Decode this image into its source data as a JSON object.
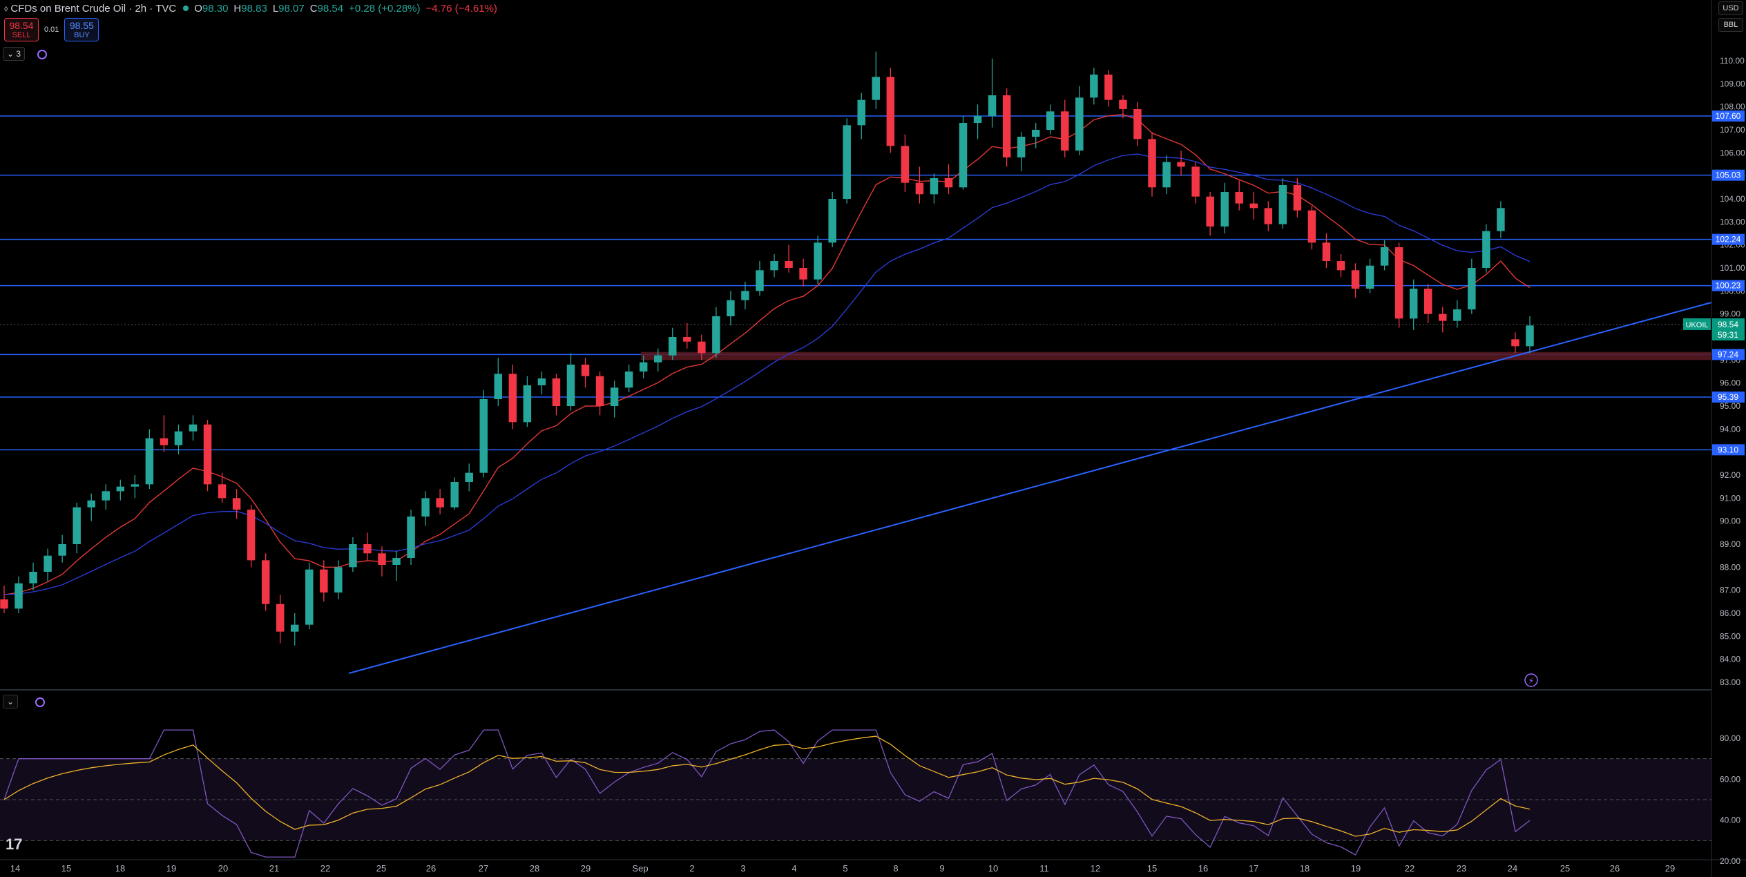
{
  "header": {
    "title": "CFDs on Brent Crude Oil · 2h · TVC",
    "open_label": "O",
    "open": "98.30",
    "high_label": "H",
    "high": "98.83",
    "low_label": "L",
    "low": "98.07",
    "close_label": "C",
    "close": "98.54",
    "change": "+0.28 (+0.28%)",
    "change2": "−4.76 (−4.61%)"
  },
  "trade": {
    "sell_price": "98.54",
    "sell_label": "SELL",
    "spread": "0.01",
    "buy_price": "98.55",
    "buy_label": "BUY"
  },
  "indicators_count": "3",
  "currency": "USD",
  "unit": "BBL",
  "colors": {
    "up": "#26a69a",
    "down": "#f23645",
    "hline": "#2962ff",
    "ma_fast": "#e53935",
    "ma_slow": "#2a3bd6",
    "rsi": "#7e57c2",
    "rsi_ma": "#f0b429"
  },
  "price_axis": {
    "ticks": [
      "110.00",
      "109.00",
      "108.00",
      "107.00",
      "106.00",
      "105.00",
      "104.00",
      "103.00",
      "102.00",
      "101.00",
      "100.00",
      "99.00",
      "98.00",
      "97.00",
      "96.00",
      "95.00",
      "94.00",
      "93.00",
      "92.00",
      "91.00",
      "90.00",
      "89.00",
      "88.00",
      "87.00",
      "86.00",
      "85.00",
      "84.00",
      "83.00"
    ],
    "levels": [
      "107.60",
      "105.03",
      "102.24",
      "100.23",
      "97.24",
      "95.39",
      "93.10"
    ],
    "current": {
      "symbol": "UKOIL",
      "price": "98.54",
      "countdown": "59:31"
    }
  },
  "rsi_axis": {
    "ticks": [
      "80.00",
      "60.00",
      "40.00",
      "20.00"
    ]
  },
  "time_axis": {
    "labels": [
      "14",
      "15",
      "18",
      "19",
      "20",
      "21",
      "22",
      "25",
      "26",
      "27",
      "28",
      "29",
      "Sep",
      "2",
      "3",
      "4",
      "5",
      "8",
      "9",
      "10",
      "11",
      "12",
      "15",
      "16",
      "17",
      "18",
      "19",
      "22",
      "23",
      "24",
      "25",
      "26",
      "29"
    ]
  },
  "chart_data": {
    "type": "candlestick",
    "symbol": "UKOIL",
    "timeframe": "2h",
    "ylim": [
      83,
      110.5
    ],
    "candles_ohlc_approx": [
      [
        86.6,
        87.2,
        86.0,
        86.2
      ],
      [
        86.2,
        87.6,
        86.0,
        87.3
      ],
      [
        87.3,
        88.2,
        87.0,
        87.8
      ],
      [
        87.8,
        88.8,
        87.4,
        88.5
      ],
      [
        88.5,
        89.4,
        88.2,
        89.0
      ],
      [
        89.0,
        90.8,
        88.6,
        90.6
      ],
      [
        90.6,
        91.2,
        90.0,
        90.9
      ],
      [
        90.9,
        91.6,
        90.5,
        91.3
      ],
      [
        91.3,
        91.8,
        90.9,
        91.5
      ],
      [
        91.5,
        92.0,
        91.0,
        91.6
      ],
      [
        91.6,
        94.0,
        91.4,
        93.6
      ],
      [
        93.6,
        94.6,
        93.0,
        93.3
      ],
      [
        93.3,
        94.2,
        92.9,
        93.9
      ],
      [
        93.9,
        94.6,
        93.5,
        94.2
      ],
      [
        94.2,
        94.4,
        91.3,
        91.6
      ],
      [
        91.6,
        92.1,
        90.8,
        91.0
      ],
      [
        91.0,
        91.4,
        90.1,
        90.5
      ],
      [
        90.5,
        90.7,
        88.0,
        88.3
      ],
      [
        88.3,
        88.6,
        86.1,
        86.4
      ],
      [
        86.4,
        86.8,
        84.7,
        85.2
      ],
      [
        85.2,
        86.0,
        84.6,
        85.5
      ],
      [
        85.5,
        88.2,
        85.3,
        87.9
      ],
      [
        87.9,
        88.3,
        86.5,
        86.9
      ],
      [
        86.9,
        88.3,
        86.6,
        88.0
      ],
      [
        88.0,
        89.3,
        87.8,
        89.0
      ],
      [
        89.0,
        89.5,
        88.3,
        88.6
      ],
      [
        88.6,
        88.9,
        87.6,
        88.1
      ],
      [
        88.1,
        88.7,
        87.4,
        88.4
      ],
      [
        88.4,
        90.5,
        88.1,
        90.2
      ],
      [
        90.2,
        91.3,
        89.8,
        91.0
      ],
      [
        91.0,
        91.4,
        90.3,
        90.6
      ],
      [
        90.6,
        91.9,
        90.5,
        91.7
      ],
      [
        91.7,
        92.5,
        91.3,
        92.1
      ],
      [
        92.1,
        95.7,
        91.9,
        95.3
      ],
      [
        95.3,
        97.1,
        95.0,
        96.4
      ],
      [
        96.4,
        96.8,
        94.0,
        94.3
      ],
      [
        94.3,
        96.3,
        94.1,
        95.9
      ],
      [
        95.9,
        96.5,
        95.5,
        96.2
      ],
      [
        96.2,
        96.4,
        94.6,
        95.0
      ],
      [
        95.0,
        97.3,
        94.8,
        96.8
      ],
      [
        96.8,
        97.1,
        95.8,
        96.3
      ],
      [
        96.3,
        96.5,
        94.6,
        95.0
      ],
      [
        95.0,
        96.1,
        94.5,
        95.8
      ],
      [
        95.8,
        96.8,
        95.6,
        96.5
      ],
      [
        96.5,
        97.2,
        96.2,
        96.9
      ],
      [
        96.9,
        97.5,
        96.5,
        97.2
      ],
      [
        97.2,
        98.4,
        97.0,
        98.0
      ],
      [
        98.0,
        98.6,
        97.5,
        97.8
      ],
      [
        97.8,
        98.1,
        97.0,
        97.3
      ],
      [
        97.3,
        99.3,
        97.1,
        98.9
      ],
      [
        98.9,
        100.0,
        98.5,
        99.6
      ],
      [
        99.6,
        100.4,
        99.2,
        100.0
      ],
      [
        100.0,
        101.3,
        99.8,
        100.9
      ],
      [
        100.9,
        101.6,
        100.6,
        101.3
      ],
      [
        101.3,
        102.0,
        100.8,
        101.0
      ],
      [
        101.0,
        101.4,
        100.2,
        100.5
      ],
      [
        100.5,
        102.4,
        100.3,
        102.1
      ],
      [
        102.1,
        104.3,
        101.9,
        104.0
      ],
      [
        104.0,
        107.5,
        103.8,
        107.2
      ],
      [
        107.2,
        108.6,
        106.6,
        108.3
      ],
      [
        108.3,
        110.4,
        107.9,
        109.3
      ],
      [
        109.3,
        109.7,
        106.0,
        106.3
      ],
      [
        106.3,
        106.8,
        104.3,
        104.7
      ],
      [
        104.7,
        105.4,
        103.8,
        104.2
      ],
      [
        104.2,
        105.1,
        103.8,
        104.9
      ],
      [
        104.9,
        105.5,
        104.2,
        104.5
      ],
      [
        104.5,
        107.6,
        104.4,
        107.3
      ],
      [
        107.3,
        108.1,
        106.6,
        107.6
      ],
      [
        107.6,
        110.1,
        107.1,
        108.5
      ],
      [
        108.5,
        108.8,
        105.4,
        105.8
      ],
      [
        105.8,
        106.9,
        105.2,
        106.7
      ],
      [
        106.7,
        107.3,
        106.2,
        107.0
      ],
      [
        107.0,
        108.1,
        106.8,
        107.8
      ],
      [
        107.8,
        108.3,
        105.8,
        106.1
      ],
      [
        106.1,
        108.9,
        105.9,
        108.4
      ],
      [
        108.4,
        109.7,
        108.1,
        109.4
      ],
      [
        109.4,
        109.6,
        108.0,
        108.3
      ],
      [
        108.3,
        108.5,
        107.5,
        107.9
      ],
      [
        107.9,
        108.2,
        106.3,
        106.6
      ],
      [
        106.6,
        106.9,
        104.1,
        104.5
      ],
      [
        104.5,
        105.9,
        104.2,
        105.6
      ],
      [
        105.6,
        106.1,
        105.0,
        105.4
      ],
      [
        105.4,
        105.6,
        103.8,
        104.1
      ],
      [
        104.1,
        104.3,
        102.4,
        102.8
      ],
      [
        102.8,
        104.7,
        102.5,
        104.3
      ],
      [
        104.3,
        104.8,
        103.5,
        103.8
      ],
      [
        103.8,
        104.3,
        103.1,
        103.6
      ],
      [
        103.6,
        103.9,
        102.6,
        102.9
      ],
      [
        102.9,
        104.9,
        102.7,
        104.6
      ],
      [
        104.6,
        104.9,
        103.2,
        103.5
      ],
      [
        103.5,
        103.7,
        101.8,
        102.1
      ],
      [
        102.1,
        102.5,
        101.0,
        101.3
      ],
      [
        101.3,
        101.6,
        100.6,
        100.9
      ],
      [
        100.9,
        101.2,
        99.7,
        100.1
      ],
      [
        100.1,
        101.4,
        99.9,
        101.1
      ],
      [
        101.1,
        102.2,
        100.9,
        101.9
      ],
      [
        101.9,
        102.1,
        98.4,
        98.8
      ],
      [
        98.8,
        100.5,
        98.3,
        100.1
      ],
      [
        100.1,
        100.3,
        98.6,
        99.0
      ],
      [
        99.0,
        99.3,
        98.2,
        98.7
      ],
      [
        98.7,
        99.6,
        98.4,
        99.2
      ],
      [
        99.2,
        101.4,
        99.0,
        101.0
      ],
      [
        101.0,
        102.9,
        100.8,
        102.6
      ],
      [
        102.6,
        103.9,
        102.3,
        103.6
      ],
      [
        97.9,
        98.2,
        97.3,
        97.6
      ],
      [
        97.6,
        98.9,
        97.3,
        98.5
      ]
    ],
    "hlines": [
      107.6,
      105.03,
      102.24,
      100.23,
      97.24,
      95.39,
      93.1
    ],
    "support_zone": [
      97.0,
      97.35
    ],
    "current_price": 98.54,
    "rsi_ylim": [
      20,
      85
    ]
  }
}
